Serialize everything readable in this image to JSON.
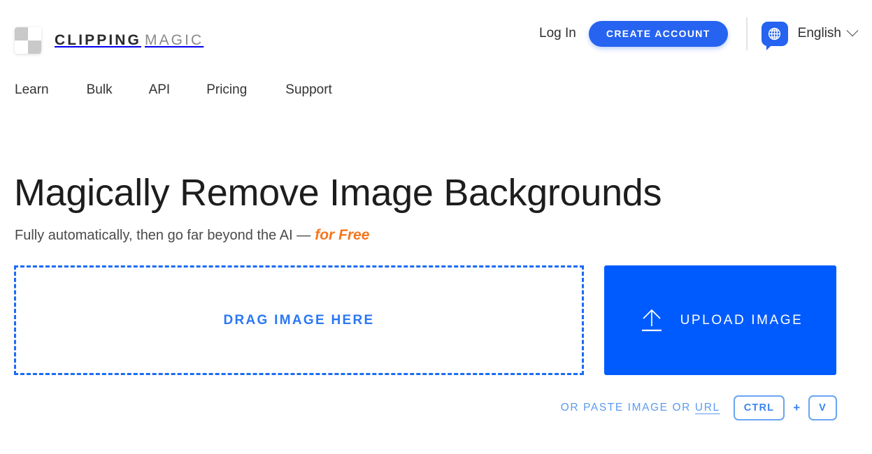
{
  "brand": {
    "logo_primary": "CLIPPING",
    "logo_secondary": "MAGIC",
    "logo_icon": "checkerboard-icon"
  },
  "header": {
    "login_label": "Log In",
    "create_account_label": "CREATE ACCOUNT",
    "language_label": "English",
    "language_icon": "globe-icon",
    "chevron_icon": "chevron-down-icon"
  },
  "nav": {
    "items": [
      {
        "label": "Learn"
      },
      {
        "label": "Bulk"
      },
      {
        "label": "API"
      },
      {
        "label": "Pricing"
      },
      {
        "label": "Support"
      }
    ]
  },
  "hero": {
    "headline": "Magically Remove Image Backgrounds",
    "subhead_prefix": "Fully automatically, then go far beyond the AI —",
    "subhead_accent": "for Free"
  },
  "uploader": {
    "dropzone_label": "DRAG IMAGE HERE",
    "upload_button_label": "UPLOAD IMAGE",
    "upload_icon": "upload-arrow-icon",
    "paste_text_before": "OR PASTE IMAGE OR",
    "paste_url_link": "URL",
    "key_ctrl": "CTRL",
    "key_plus": "+",
    "key_v": "V"
  },
  "colors": {
    "brand_blue": "#005bff",
    "button_blue": "#2563f0",
    "dashed_blue": "#1b6bf5",
    "link_blue": "#5b9bf0",
    "accent_orange": "#f7761e",
    "logo_gray": "#c9c9c9"
  }
}
